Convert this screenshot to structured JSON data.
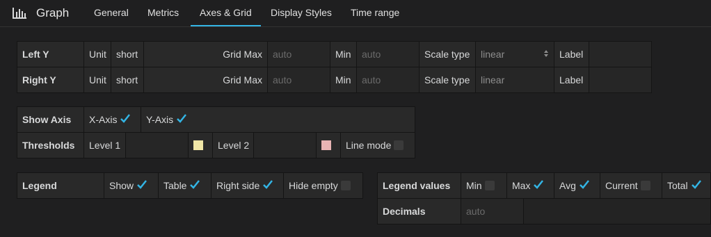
{
  "header": {
    "title": "Graph",
    "tabs": [
      {
        "label": "General"
      },
      {
        "label": "Metrics"
      },
      {
        "label": "Axes & Grid"
      },
      {
        "label": "Display Styles"
      },
      {
        "label": "Time range"
      }
    ],
    "active_tab": "Axes & Grid",
    "accent": "#33b5e5"
  },
  "axes": {
    "left": {
      "label": "Left Y",
      "unit_label": "Unit",
      "unit_value": "short",
      "grid_max_label": "Grid Max",
      "grid_max_placeholder": "auto",
      "min_label": "Min",
      "min_placeholder": "auto",
      "scale_type_label": "Scale type",
      "scale_type_value": "linear",
      "label_label": "Label"
    },
    "right": {
      "label": "Right Y",
      "unit_label": "Unit",
      "unit_value": "short",
      "grid_max_label": "Grid Max",
      "grid_max_placeholder": "auto",
      "min_label": "Min",
      "min_placeholder": "auto",
      "scale_type_label": "Scale type",
      "scale_type_value": "linear",
      "label_label": "Label"
    }
  },
  "show_axis": {
    "label": "Show Axis",
    "x_axis": {
      "label": "X-Axis",
      "checked": true
    },
    "y_axis": {
      "label": "Y-Axis",
      "checked": true
    }
  },
  "thresholds": {
    "label": "Thresholds",
    "level1_label": "Level 1",
    "level1_color": "#f0e6a6",
    "level2_label": "Level 2",
    "level2_color": "#e8b4b4",
    "line_mode": {
      "label": "Line mode",
      "checked": false
    }
  },
  "legend": {
    "label": "Legend",
    "show": {
      "label": "Show",
      "checked": true
    },
    "table": {
      "label": "Table",
      "checked": true
    },
    "right_side": {
      "label": "Right side",
      "checked": true
    },
    "hide_empty": {
      "label": "Hide empty",
      "checked": false
    }
  },
  "legend_values": {
    "label": "Legend values",
    "min": {
      "label": "Min",
      "checked": false
    },
    "max": {
      "label": "Max",
      "checked": true
    },
    "avg": {
      "label": "Avg",
      "checked": true
    },
    "current": {
      "label": "Current",
      "checked": false
    },
    "total": {
      "label": "Total",
      "checked": true
    },
    "decimals_label": "Decimals",
    "decimals_placeholder": "auto"
  }
}
